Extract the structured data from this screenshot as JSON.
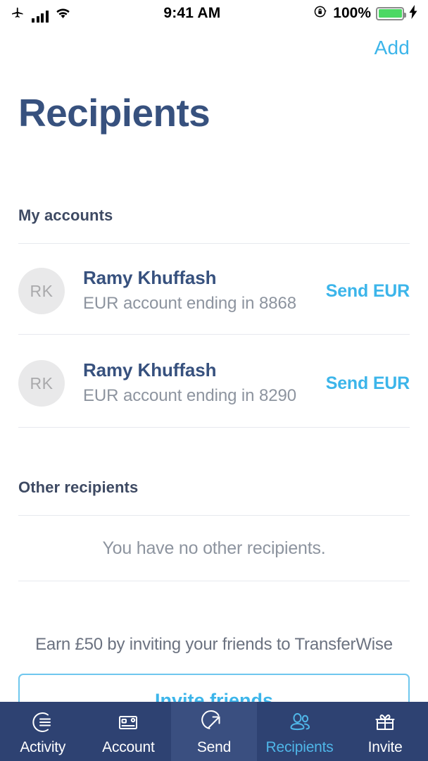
{
  "status_bar": {
    "airplane_icon": "airplane-mode-icon",
    "signal_icon": "cellular-signal-icon",
    "wifi_icon": "wifi-icon",
    "time": "9:41 AM",
    "rotation_lock_icon": "rotation-lock-icon",
    "battery_percent": "100%",
    "battery_icon": "battery-full-icon",
    "charging_icon": "lightning-bolt-icon",
    "battery_color": "#4cd964"
  },
  "header": {
    "add_label": "Add",
    "title": "Recipients",
    "accent_color": "#3cb5ea",
    "title_color": "#37517e"
  },
  "my_accounts": {
    "section_label": "My accounts",
    "rows": [
      {
        "initials": "RK",
        "name": "Ramy Khuffash",
        "detail": "EUR account ending in 8868",
        "action": "Send EUR"
      },
      {
        "initials": "RK",
        "name": "Ramy Khuffash",
        "detail": "EUR account ending in 8290",
        "action": "Send EUR"
      }
    ]
  },
  "other_recipients": {
    "section_label": "Other recipients",
    "empty_message": "You have no other recipients."
  },
  "promo": {
    "text": "Earn £50 by inviting your friends to TransferWise",
    "button_label": "Invite friends"
  },
  "tabbar": {
    "background_color": "#2e4272",
    "active_color": "#4fb6e8",
    "items": [
      {
        "label": "Activity",
        "icon": "activity-icon",
        "active": false,
        "highlight": false
      },
      {
        "label": "Account",
        "icon": "card-icon",
        "active": false,
        "highlight": false
      },
      {
        "label": "Send",
        "icon": "send-arrow-icon",
        "active": false,
        "highlight": true
      },
      {
        "label": "Recipients",
        "icon": "people-icon",
        "active": true,
        "highlight": false
      },
      {
        "label": "Invite",
        "icon": "gift-icon",
        "active": false,
        "highlight": false
      }
    ]
  }
}
